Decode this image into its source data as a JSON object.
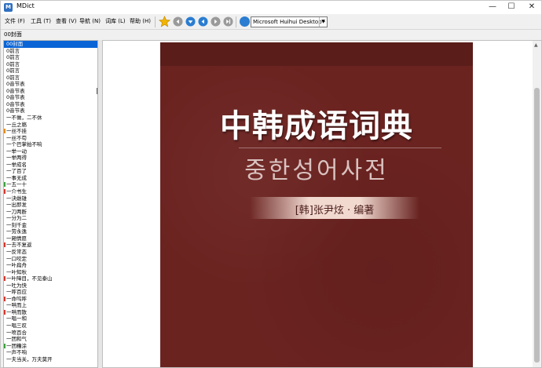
{
  "window": {
    "title": "MDict",
    "controls": {
      "minimize": "—",
      "maximize": "☐",
      "close": "✕"
    }
  },
  "menu": [
    {
      "label": "文件 (F)"
    },
    {
      "label": "工具 (T)"
    },
    {
      "label": "查看 (V)"
    },
    {
      "label": "导航 (N)"
    },
    {
      "label": "词库 (L)"
    },
    {
      "label": "帮助 (H)"
    }
  ],
  "toolbar": {
    "icons": [
      "star-icon",
      "back-icon",
      "down-icon",
      "previous-icon",
      "next-icon",
      "forward-icon"
    ],
    "dictionary_selected": "Microsoft Huihui Desktop - C",
    "colors": {
      "star": "#f2b400",
      "nav_gray": "#9a9a9a",
      "nav_blue": "#2a7dd1"
    }
  },
  "search": {
    "value": "00封面"
  },
  "wordlist": {
    "items": [
      {
        "text": "00封面",
        "selected": true
      },
      {
        "text": "0前言"
      },
      {
        "text": "0前言"
      },
      {
        "text": "0前言"
      },
      {
        "text": "0前言"
      },
      {
        "text": "0前言"
      },
      {
        "text": "0音节表"
      },
      {
        "text": "0音节表"
      },
      {
        "text": "0音节表"
      },
      {
        "text": "0音节表"
      },
      {
        "text": "0音节表"
      },
      {
        "text": "一不做，二不休"
      },
      {
        "text": "一丘之貉"
      },
      {
        "text": "一丝不挂"
      },
      {
        "text": "一丝不苟"
      },
      {
        "text": "一个巴掌拍不响"
      },
      {
        "text": "一举一动"
      },
      {
        "text": "一举两得"
      },
      {
        "text": "一举成名"
      },
      {
        "text": "一了百了"
      },
      {
        "text": "一事无成"
      },
      {
        "text": "一五一十"
      },
      {
        "text": "一介书生"
      },
      {
        "text": "一決雌雄"
      },
      {
        "text": "一出即发"
      },
      {
        "text": "一刀两断"
      },
      {
        "text": "一分为二"
      },
      {
        "text": "一刻千金"
      },
      {
        "text": "一劳永逸"
      },
      {
        "text": "一厢情愿"
      },
      {
        "text": "一去不复返"
      },
      {
        "text": "一反常态"
      },
      {
        "text": "一口咬定"
      },
      {
        "text": "一叶扁舟"
      },
      {
        "text": "一叶知秋"
      },
      {
        "text": "一叶障目，不见泰山"
      },
      {
        "text": "一吐为快"
      },
      {
        "text": "一呼百应"
      },
      {
        "text": "一命呜呼"
      },
      {
        "text": "一哄而上"
      },
      {
        "text": "一哄而散"
      },
      {
        "text": "一唱一和"
      },
      {
        "text": "一唱三叹"
      },
      {
        "text": "一喷百合"
      },
      {
        "text": "一团和气"
      },
      {
        "text": "一团糟涂"
      },
      {
        "text": "一声不响"
      },
      {
        "text": "一夫当关，万夫莫开"
      }
    ],
    "marker_colors": {
      "red": "#d9342b",
      "green": "#3aa13a",
      "orange": "#e88a1a"
    }
  },
  "cover": {
    "title": "中韩成语词典",
    "subtitle": "중한성어사전",
    "author": "[韩]张尹炫 · 编著",
    "colors": {
      "background": "#6b2320",
      "title": "#ffffff",
      "subtitle": "#d9c2c0",
      "author_band": "#f1d9d0"
    }
  }
}
